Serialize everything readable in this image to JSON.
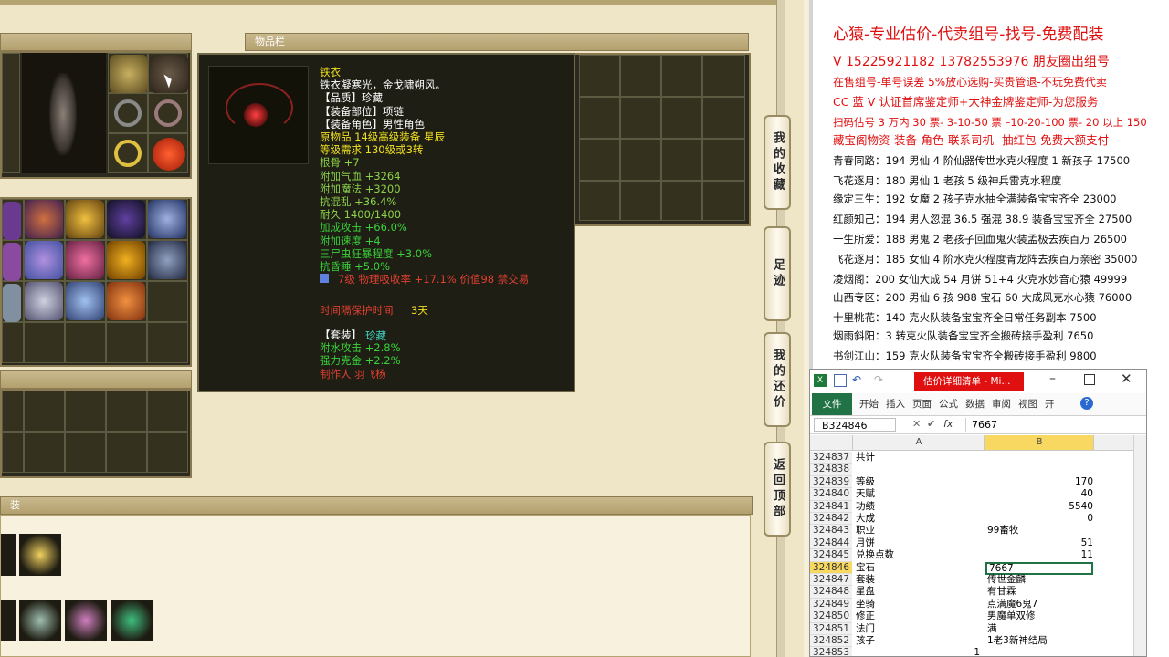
{
  "game": {
    "inventory_panel_title": "物品栏",
    "suit_panel_title": "装",
    "tooltip": {
      "lines": [
        {
          "text": "铁衣",
          "color": "#f0e020"
        },
        {
          "text": "铁衣凝寒光，金戈啸朔风。",
          "color": "#ffffff"
        },
        {
          "text": "【品质】珍藏",
          "color": "#ffffff"
        },
        {
          "text": "【装备部位】项链",
          "color": "#ffffff"
        },
        {
          "text": "【装备角色】男性角色",
          "color": "#ffffff"
        },
        {
          "text": "原物品 14级高级装备 星辰",
          "color": "#f0e020"
        },
        {
          "text": "等级需求 130级或3转",
          "color": "#f0e020"
        },
        {
          "text": "根骨 +7",
          "color": "#8cd24a"
        },
        {
          "text": "附加气血 +3264",
          "color": "#8cd24a"
        },
        {
          "text": "附加魔法 +3200",
          "color": "#8cd24a"
        },
        {
          "text": "抗混乱 +36.4%",
          "color": "#8cd24a"
        },
        {
          "text": "耐久 1400/1400",
          "color": "#8cd24a"
        },
        {
          "text": "加成攻击 +66.0%",
          "color": "#3ad23a"
        },
        {
          "text": "附加速度 +4",
          "color": "#3ad23a"
        },
        {
          "text": "三尸虫狂暴程度 +3.0%",
          "color": "#3ad23a"
        },
        {
          "text": "抗昏睡 +5.0%",
          "color": "#3ad23a"
        }
      ],
      "gem_line": "7级 物理吸收率 +17.1% 价值98 禁交易",
      "protect_label": "时间隔保护时间",
      "protect_value": "3天",
      "suit_lines": [
        {
          "text": "【套装】",
          "color": "#ffffff"
        },
        {
          "text": "附水攻击 +2.8%",
          "color": "#3ad23a"
        },
        {
          "text": "强力克金 +2.2%",
          "color": "#3ad23a"
        },
        {
          "text": "制作人 羽飞杨",
          "color": "#e04030"
        }
      ],
      "suit_name": "珍藏"
    },
    "side_buttons": [
      {
        "label": "我的收藏"
      },
      {
        "label": "足迹"
      },
      {
        "label": "我的还价"
      },
      {
        "label": "返回顶部"
      }
    ]
  },
  "doc": {
    "lines": [
      {
        "text": "心猿-专业估价-代卖组号-找号-免费配装",
        "color": "#e01010",
        "size": 17
      },
      {
        "text": "V 15225921182   13782553976 朋友圈出组号",
        "color": "#e01010",
        "size": 14
      },
      {
        "text": "在售组号-单号误差 5%放心选购-买贵管退-不玩免费代卖",
        "color": "#e01010",
        "size": 12
      },
      {
        "text": "CC 蓝 V 认证首席鉴定师+大神金牌鉴定师-为您服务",
        "color": "#e01010",
        "size": 12.5
      },
      {
        "text": "扫码估号 3 万内 30 票- 3-10-50 票  –10-20-100 票- 20 以上 150",
        "color": "#e01010",
        "size": 11.5
      },
      {
        "text": "藏宝阁物资-装备-角色-联系司机--抽红包-免费大额支付",
        "color": "#e01010",
        "size": 12.5
      },
      {
        "text": "青春同路：194 男仙 4 阶仙器传世水克火程度 1 新孩子 17500",
        "color": "#111111",
        "size": 11.5
      },
      {
        "text": "飞花逐月：180 男仙 1 老孩 5 级神兵雷克水程度",
        "color": "#111111",
        "size": 11.5
      },
      {
        "text": "缘定三生：192 女魔 2 孩子克水抽全满装备宝宝齐全 23000",
        "color": "#111111",
        "size": 11.5
      },
      {
        "text": "红颜知己：194 男人忽混 36.5 强混 38.9 装备宝宝齐全 27500",
        "color": "#111111",
        "size": 11.5
      },
      {
        "text": "一生所爱：188 男鬼 2 老孩子回血鬼火装孟极去疾百万 26500",
        "color": "#111111",
        "size": 11.5
      },
      {
        "text": "飞花逐月：185 女仙 4 阶水克火程度青龙阵去疾百万亲密 35000",
        "color": "#111111",
        "size": 11.5
      },
      {
        "text": "凌烟阁：200 女仙大成 54 月饼 51+4 火克水妙音心猿 49999",
        "color": "#111111",
        "size": 11.5
      },
      {
        "text": "山西专区：200 男仙 6 孩 988 宝石 60 大成风克水心猿 76000",
        "color": "#111111",
        "size": 11.5
      },
      {
        "text": "十里桃花：140 克火队装备宝宝齐全日常任务副本 7500",
        "color": "#111111",
        "size": 11.5
      },
      {
        "text": "烟雨斜阳：3 转克火队装备宝宝齐全搬砖接手盈利 7650",
        "color": "#111111",
        "size": 11.5
      },
      {
        "text": "书剑江山：159 克火队装备宝宝齐全搬砖接手盈利 9800",
        "color": "#111111",
        "size": 11.5
      }
    ]
  },
  "excel": {
    "title": "估价详细清单 - Mi...",
    "tabs": [
      "文件",
      "开始",
      "插入",
      "页面",
      "公式",
      "数据",
      "审阅",
      "视图",
      "开"
    ],
    "name_box": "B324846",
    "formula_value": "7667",
    "col_a": "A",
    "col_b": "B",
    "rows": [
      {
        "num": "324837",
        "a": "共计",
        "b": "",
        "align": "left"
      },
      {
        "num": "324838",
        "a": "",
        "b": "",
        "align": "left"
      },
      {
        "num": "324839",
        "a": "等级",
        "b": "170",
        "align": "right"
      },
      {
        "num": "324840",
        "a": "天赋",
        "b": "40",
        "align": "right"
      },
      {
        "num": "324841",
        "a": "功绩",
        "b": "5540",
        "align": "right"
      },
      {
        "num": "324842",
        "a": "大成",
        "b": "0",
        "align": "right"
      },
      {
        "num": "324843",
        "a": "职业",
        "b": "99畜牧",
        "align": "left"
      },
      {
        "num": "324844",
        "a": "月饼",
        "b": "51",
        "align": "right"
      },
      {
        "num": "324845",
        "a": "兑换点数",
        "b": "11",
        "align": "right"
      },
      {
        "num": "324846",
        "a": "宝石",
        "b": "7667",
        "align": "left"
      },
      {
        "num": "324847",
        "a": "套装",
        "b": "传世金麟",
        "align": "left"
      },
      {
        "num": "324848",
        "a": "星盘",
        "b": "有甘霖",
        "align": "left"
      },
      {
        "num": "324849",
        "a": "坐骑",
        "b": "点满魔6鬼7",
        "align": "left"
      },
      {
        "num": "324850",
        "a": "修正",
        "b": "男魔单双修",
        "align": "left"
      },
      {
        "num": "324851",
        "a": "法门",
        "b": "满",
        "align": "left"
      },
      {
        "num": "324852",
        "a": "孩子",
        "b": "1老3新神结局",
        "align": "left"
      },
      {
        "num": "324853",
        "a": "1",
        "b": "",
        "align": "right"
      }
    ]
  }
}
